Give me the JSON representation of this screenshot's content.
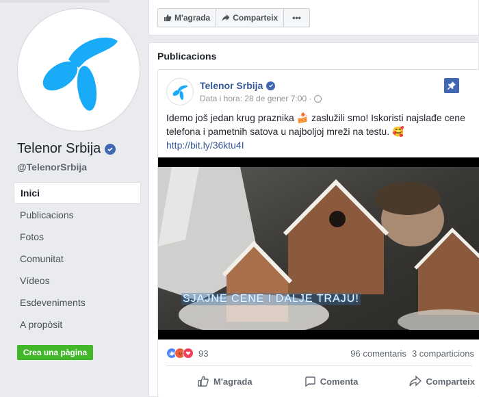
{
  "page": {
    "name": "Telenor Srbija",
    "handle": "@TelenorSrbija"
  },
  "nav": [
    {
      "label": "Inici",
      "active": true
    },
    {
      "label": "Publicacions",
      "active": false
    },
    {
      "label": "Fotos",
      "active": false
    },
    {
      "label": "Comunitat",
      "active": false
    },
    {
      "label": "Vídeos",
      "active": false
    },
    {
      "label": "Esdeveniments",
      "active": false
    },
    {
      "label": "A propòsit",
      "active": false
    }
  ],
  "create_page_label": "Crea una pàgina",
  "top_actions": {
    "like_label": "M'agrada",
    "share_label": "Comparteix",
    "more_label": "•••"
  },
  "publications": {
    "title": "Publicacions"
  },
  "post": {
    "author": "Telenor Srbija",
    "meta": "Data i hora: 28 de gener 7:00 ·",
    "text": "Idemo još jedan krug praznika 🍰 zaslužili smo! Iskoristi najslađe cene telefona i pametnih satova u najboljoj mreži na testu. 🥰",
    "link": "http://bit.ly/36ktu4I",
    "video_caption": "SJAJNE CENE I DALJE TRAJU!",
    "reaction_count": "93",
    "comments": "96 comentaris",
    "shares": "3 comparticions",
    "actions": {
      "like": "M'agrada",
      "comment": "Comenta",
      "share": "Comparteix"
    }
  },
  "colors": {
    "brand": "#19aaf8",
    "facebook_blue": "#4267b2",
    "link": "#365899",
    "create_button": "#42b72a"
  }
}
